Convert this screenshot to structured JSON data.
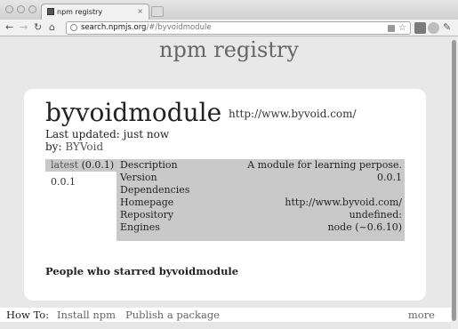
{
  "browser": {
    "tab_title": "npm registry",
    "tab_close": "×",
    "url_host": "search.npmjs.org",
    "url_path": "/#/byvoidmodule"
  },
  "page": {
    "site_title": "npm registry",
    "module_name": "byvoidmodule",
    "module_url": "http://www.byvoid.com/",
    "last_updated": "Last updated: just now",
    "by_label": "by: ",
    "author": "BYVoid",
    "versions": {
      "tag": "latest",
      "tag_version": "(0.0.1)",
      "list": [
        "0.0.1"
      ]
    },
    "info": [
      {
        "key": "Description",
        "value": "A module for learning perpose."
      },
      {
        "key": "Version",
        "value": "0.0.1"
      },
      {
        "key": "Dependencies",
        "value": ""
      },
      {
        "key": "Homepage",
        "value": "http://www.byvoid.com/"
      },
      {
        "key": "Repository",
        "value": "undefined:"
      },
      {
        "key": "Engines",
        "value": "node (~0.6.10)"
      }
    ],
    "starred_heading": "People who starred byvoidmodule"
  },
  "footer": {
    "howto": "How To:",
    "install": "Install npm",
    "publish": "Publish a package",
    "more": "more"
  },
  "icons": {
    "back": "back-arrow-icon",
    "forward": "forward-arrow-icon",
    "reload": "reload-icon",
    "home": "home-icon",
    "star": "bookmark-star-icon",
    "wrench": "wrench-icon"
  }
}
